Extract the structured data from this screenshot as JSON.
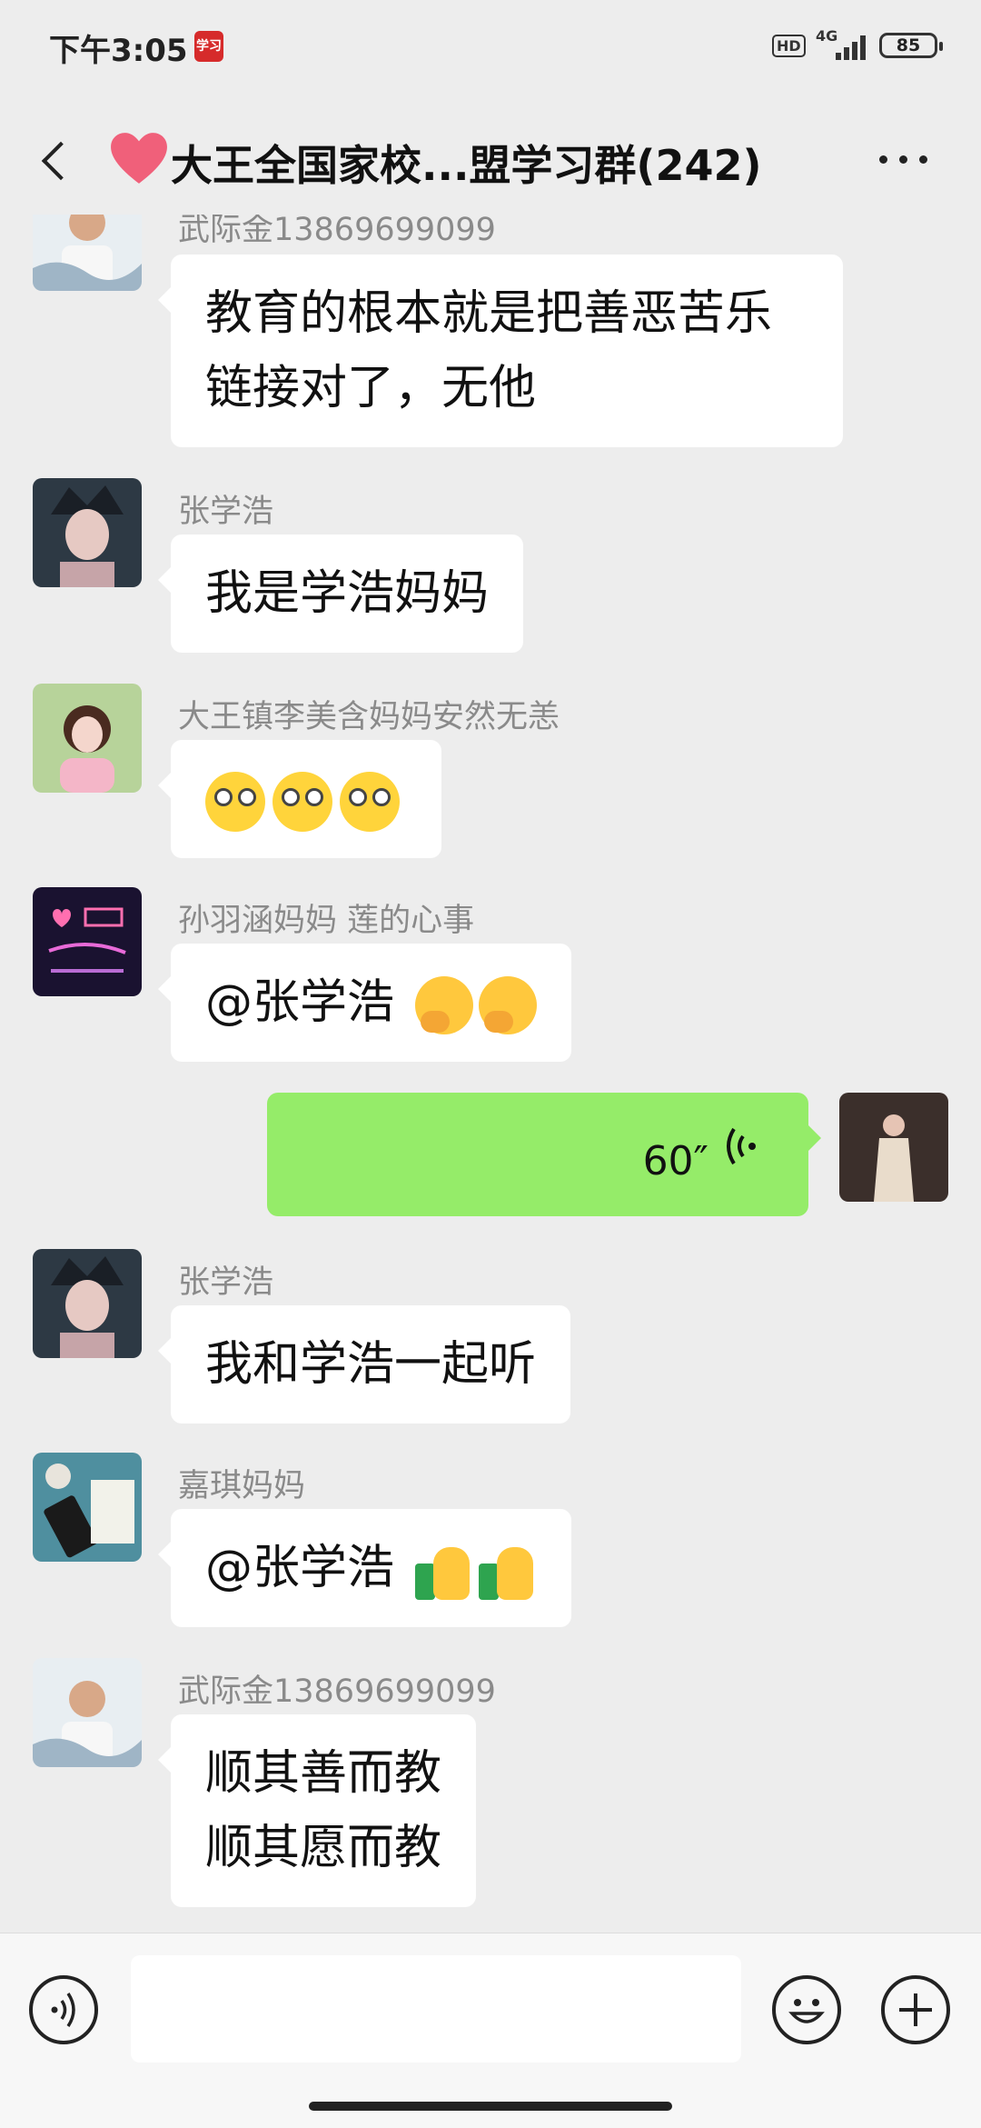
{
  "status_bar": {
    "time": "下午3:05",
    "app_badge": "学习",
    "hd": "HD",
    "network": "4G",
    "battery": "85"
  },
  "header": {
    "title": "大王全国家校...盟学习群(242)",
    "heart_color": "#f0607a"
  },
  "messages": [
    {
      "sender": "武际金13869699099",
      "lines": [
        "教育的根本就是把善恶苦乐",
        "链接对了，无他"
      ],
      "avatar": "man-white-shirt-avatar"
    },
    {
      "sender": "张学浩",
      "lines": [
        "我是学浩妈妈"
      ],
      "avatar": "anime-boy-avatar"
    },
    {
      "sender": "大王镇李美含妈妈安然无恙",
      "emoji": [
        "pleading-face",
        "pleading-face",
        "pleading-face"
      ],
      "avatar": "girl-pink-avatar"
    },
    {
      "sender": "孙羽涵妈妈  莲的心事",
      "text": "@张学浩 ",
      "emoji": [
        "hugging-face",
        "hugging-face"
      ],
      "avatar": "neon-sign-avatar"
    },
    {
      "self": true,
      "voice_duration": "60″",
      "avatar": "self-photo-avatar"
    },
    {
      "sender": "张学浩",
      "lines": [
        "我和学浩一起听"
      ],
      "avatar": "anime-boy-avatar"
    },
    {
      "sender": "嘉琪妈妈",
      "text": "@张学浩 ",
      "emoji": [
        "thumbs-up",
        "thumbs-up"
      ],
      "avatar": "desk-photo-avatar"
    },
    {
      "sender": "武际金13869699099",
      "lines": [
        "顺其善而教",
        "顺其愿而教"
      ],
      "avatar": "man-white-shirt-avatar"
    }
  ],
  "input": {
    "value": "",
    "placeholder": ""
  },
  "colors": {
    "self_bubble": "#95ec69",
    "other_bubble": "#ffffff",
    "background": "#ededed"
  }
}
